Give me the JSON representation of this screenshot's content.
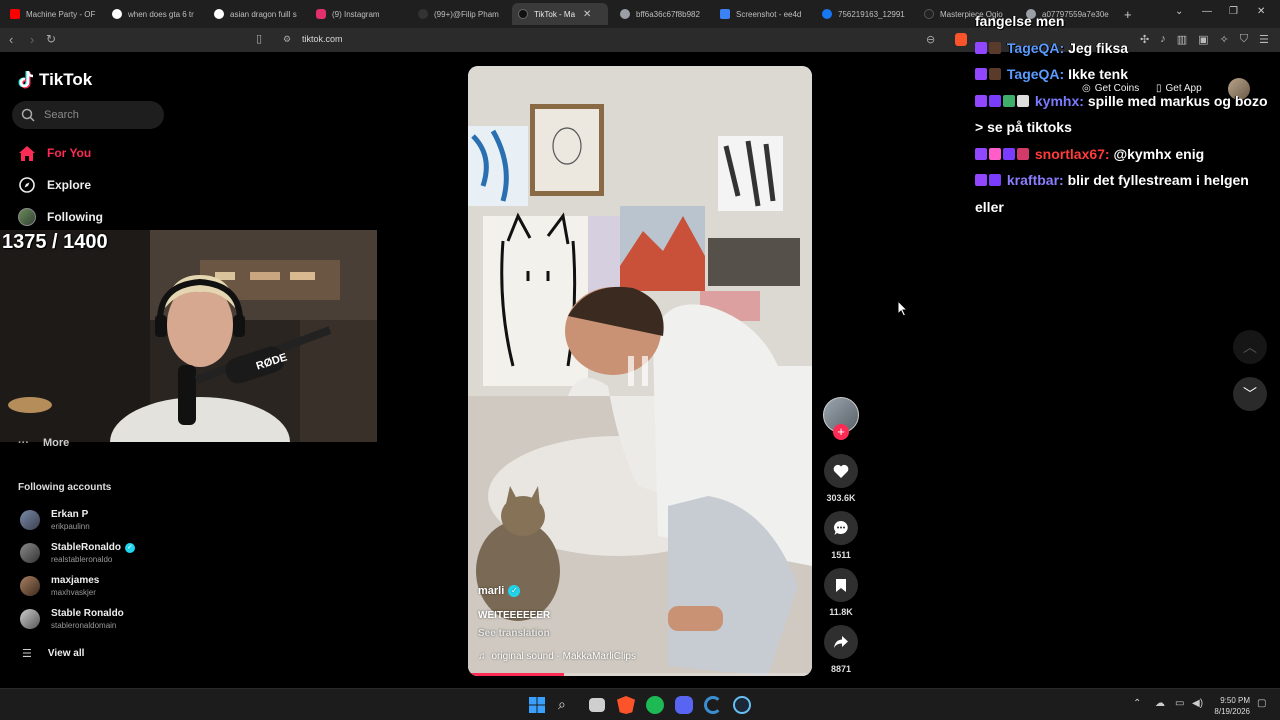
{
  "browser": {
    "tabs": [
      {
        "title": "Machine Party - OF",
        "color": "#ff0000"
      },
      {
        "title": "when does gta 6 tr",
        "color": "#ffffff"
      },
      {
        "title": "asian dragon fuill s",
        "color": "#ffffff"
      },
      {
        "title": "(9) Instagram",
        "color": "#e1306c"
      },
      {
        "title": "(99+)@Filip Pham",
        "color": "#000000"
      },
      {
        "title": "TikTok - Ma",
        "color": "#000000",
        "active": true
      },
      {
        "title": "bff6a36c67f8b982",
        "color": "#9aa0a6"
      },
      {
        "title": "Screenshot - ee4d",
        "color": "#3b82f6"
      },
      {
        "title": "756219163_12991",
        "color": "#1877f2"
      },
      {
        "title": "Masterpiece Ogio",
        "color": "#000000"
      },
      {
        "title": "a07797559a7e30e",
        "color": "#9aa0a6"
      }
    ],
    "new_tab": "+",
    "url": "tiktok.com"
  },
  "sidebar": {
    "logo": "TikTok",
    "search_placeholder": "Search",
    "nav": [
      {
        "label": "For You",
        "icon": "home-icon",
        "active": true
      },
      {
        "label": "Explore",
        "icon": "compass-icon"
      },
      {
        "label": "Following",
        "icon": "following-avatar-icon"
      }
    ],
    "more": "More",
    "following_title": "Following accounts",
    "accounts": [
      {
        "name": "Erkan P",
        "handle": "erikpaulinn",
        "verified": false
      },
      {
        "name": "StableRonaldo",
        "handle": "realstableronaldo",
        "verified": true
      },
      {
        "name": "maxjames",
        "handle": "maxhvaskjer",
        "verified": false
      },
      {
        "name": "Stable Ronaldo",
        "handle": "stableronaldomain",
        "verified": false
      }
    ],
    "view_all": "View all"
  },
  "stream": {
    "counter": "1375 / 1400"
  },
  "video": {
    "author": "marli",
    "caption": "WEITEEEEEER",
    "see_translation": "See translation",
    "sound": "original sound - MakkaMarliClips",
    "progress": 0.28
  },
  "actions": {
    "likes": "303.6K",
    "comments": "1511",
    "saves": "11.8K",
    "shares": "8871"
  },
  "topbar": {
    "get_coins": "Get Coins",
    "get_app": "Get App"
  },
  "chat": [
    {
      "user": "",
      "text": "fangelse men",
      "color": "#ffffff"
    },
    {
      "user": "TageQA:",
      "text": "Jeg fiksa",
      "color": "#5b9bff"
    },
    {
      "user": "TageQA:",
      "text": "Ikke tenk",
      "color": "#5b9bff"
    },
    {
      "user": "kymhx:",
      "text": "spille med markus og bozo > se på tiktoks",
      "color": "#7b7bff"
    },
    {
      "user": "snortlax67:",
      "text": "@kymhx enig",
      "color": "#ff3b3b"
    },
    {
      "user": "kraftbar:",
      "text": "blir det fyllestream i helgen eller",
      "color": "#8a7dff"
    }
  ],
  "taskbar": {
    "time": "9:50 PM",
    "date": "8/19/2026"
  }
}
